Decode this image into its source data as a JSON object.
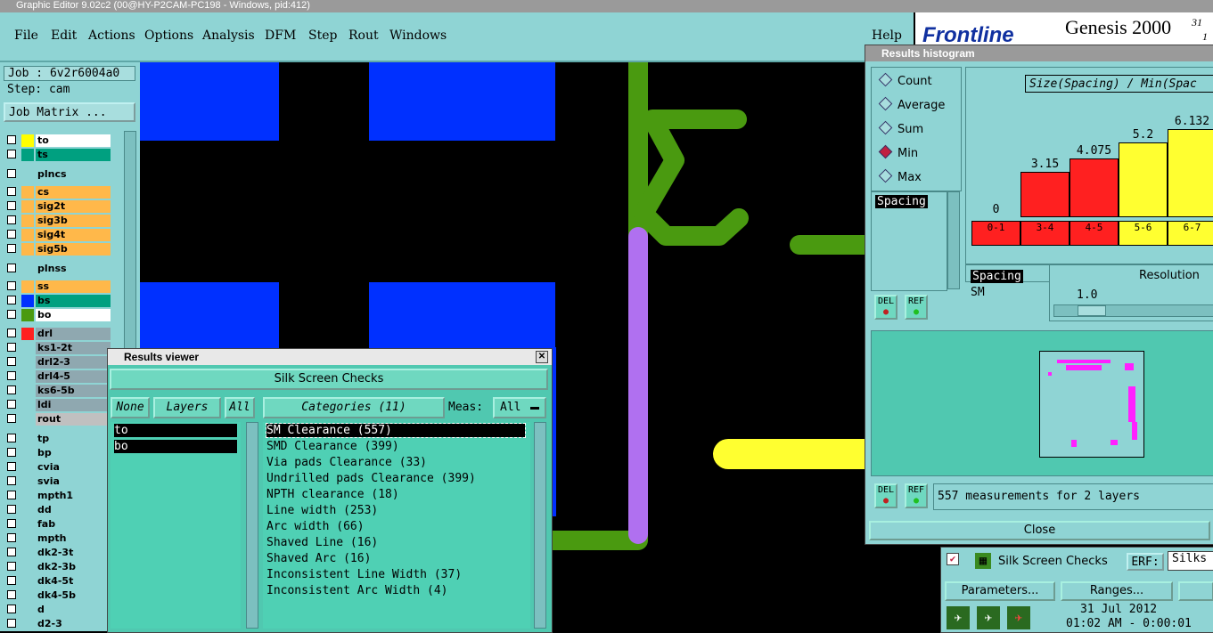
{
  "window": {
    "title": "Graphic Editor 9.02c2 (00@HY-P2CAM-PC198 - Windows, pid:412)"
  },
  "menu": [
    "File",
    "Edit",
    "Actions",
    "Options",
    "Analysis",
    "DFM",
    "Step",
    "Rout",
    "Windows"
  ],
  "help": "Help",
  "brand": {
    "logo": "Frontline",
    "product": "Genesis 2000",
    "version_top": "31",
    "version_bottom": "1"
  },
  "job": {
    "job_label": "Job :  6v2r6004a0",
    "step_label": "Step: cam",
    "matrix_button": "Job Matrix ..."
  },
  "layers": [
    {
      "name": "to",
      "swatch": "#ffff00",
      "bg": "#ffffff"
    },
    {
      "name": "ts",
      "swatch": "#00a080",
      "bg": "#00a080"
    },
    {
      "name": "plncs",
      "swatch": "#8fd4d4",
      "bg": "#8fd4d4"
    },
    {
      "name": "cs",
      "swatch": "#ffb84a",
      "bg": "#ffb84a"
    },
    {
      "name": "sig2t",
      "swatch": "#ffb84a",
      "bg": "#ffb84a"
    },
    {
      "name": "sig3b",
      "swatch": "#ffb84a",
      "bg": "#ffb84a"
    },
    {
      "name": "sig4t",
      "swatch": "#ffb84a",
      "bg": "#ffb84a"
    },
    {
      "name": "sig5b",
      "swatch": "#ffb84a",
      "bg": "#ffb84a"
    },
    {
      "name": "plnss",
      "swatch": "#8fd4d4",
      "bg": "#8fd4d4"
    },
    {
      "name": "ss",
      "swatch": "#ffb84a",
      "bg": "#ffb84a"
    },
    {
      "name": "bs",
      "swatch": "#0030ff",
      "bg": "#00a080"
    },
    {
      "name": "bo",
      "swatch": "#4a9a10",
      "bg": "#ffffff"
    },
    {
      "name": "drl",
      "swatch": "#ff2020",
      "bg": "#8fa8b0"
    },
    {
      "name": "ks1-2t",
      "swatch": "#8fd4d4",
      "bg": "#8fa8b0"
    },
    {
      "name": "drl2-3",
      "swatch": "#8fd4d4",
      "bg": "#8fa8b0"
    },
    {
      "name": "drl4-5",
      "swatch": "#8fd4d4",
      "bg": "#8fa8b0"
    },
    {
      "name": "ks6-5b",
      "swatch": "#8fd4d4",
      "bg": "#8fa8b0"
    },
    {
      "name": "ldi",
      "swatch": "#8fd4d4",
      "bg": "#8fa8b0"
    },
    {
      "name": "rout",
      "swatch": "#8fd4d4",
      "bg": "#c0c0c0"
    },
    {
      "name": "tp",
      "swatch": "#8fd4d4",
      "bg": "#8fd4d4"
    },
    {
      "name": "bp",
      "swatch": "#8fd4d4",
      "bg": "#8fd4d4"
    },
    {
      "name": "cvia",
      "swatch": "#8fd4d4",
      "bg": "#8fd4d4"
    },
    {
      "name": "svia",
      "swatch": "#8fd4d4",
      "bg": "#8fd4d4"
    },
    {
      "name": "mpth1",
      "swatch": "#8fd4d4",
      "bg": "#8fd4d4"
    },
    {
      "name": "dd",
      "swatch": "#8fd4d4",
      "bg": "#8fd4d4"
    },
    {
      "name": "fab",
      "swatch": "#8fd4d4",
      "bg": "#8fd4d4"
    },
    {
      "name": "mpth",
      "swatch": "#8fd4d4",
      "bg": "#8fd4d4"
    },
    {
      "name": "dk2-3t",
      "swatch": "#8fd4d4",
      "bg": "#8fd4d4"
    },
    {
      "name": "dk2-3b",
      "swatch": "#8fd4d4",
      "bg": "#8fd4d4"
    },
    {
      "name": "dk4-5t",
      "swatch": "#8fd4d4",
      "bg": "#8fd4d4"
    },
    {
      "name": "dk4-5b",
      "swatch": "#8fd4d4",
      "bg": "#8fd4d4"
    },
    {
      "name": "d",
      "swatch": "#8fd4d4",
      "bg": "#8fd4d4"
    },
    {
      "name": "d2-3",
      "swatch": "#8fd4d4",
      "bg": "#8fd4d4"
    }
  ],
  "results_viewer": {
    "title": "Results viewer",
    "header": "Silk Screen Checks",
    "none_btn": "None",
    "layers_btn": "Layers",
    "all_btn": "All",
    "categories_btn": "Categories (11)",
    "meas_label": "Meas:",
    "meas_value": "All",
    "layer_items": [
      "to",
      "bo"
    ],
    "categories": [
      "SM Clearance (557)",
      "SMD Clearance (399)",
      "Via pads Clearance (33)",
      "Undrilled pads Clearance (399)",
      "NPTH clearance (18)",
      "Line width (253)",
      "Arc width (66)",
      "Shaved Line (16)",
      "Shaved Arc (16)",
      "Inconsistent Line Width (37)",
      "Inconsistent Arc Width (4)"
    ]
  },
  "histogram": {
    "title": "Results histogram",
    "modes": [
      "Count",
      "Average",
      "Sum",
      "Min",
      "Max"
    ],
    "selected_mode": "Min",
    "chart_title": "Size(Spacing) / Min(Spac",
    "list_item": "Spacing",
    "del": "DEL",
    "ref": "REF",
    "sel_items": [
      "Spacing",
      "SM"
    ],
    "resolution_label": "Resolution",
    "resolution_value": "1.0",
    "status": "557 measurements for 2 layers",
    "close": "Close"
  },
  "chart_data": {
    "type": "bar",
    "categories": [
      "0-1",
      "3-4",
      "4-5",
      "5-6",
      "6-7"
    ],
    "values": [
      0,
      3.15,
      4.075,
      5.2,
      6.132
    ],
    "value_labels": [
      "0",
      "3.15",
      "4.075",
      "5.2",
      "6.132"
    ],
    "colors": [
      "#ff2020",
      "#ff2020",
      "#ff2020",
      "#ffff30",
      "#ffff30"
    ],
    "ylim": [
      0,
      6.5
    ]
  },
  "bottom_panel": {
    "title": "Silk Screen Checks",
    "erf_label": "ERF:",
    "erf_value": "Silks",
    "parameters": "Parameters...",
    "ranges": "Ranges...",
    "date": "31 Jul 2012",
    "time": "01:02 AM - 0:00:01"
  },
  "colors": {
    "panel": "#8fd4d4",
    "results_bg": "#50c8b0",
    "blue_pad": "#0030ff",
    "green_trace": "#4a9a10",
    "purple_trace": "#b070f0",
    "yellow_trace": "#ffff30"
  }
}
